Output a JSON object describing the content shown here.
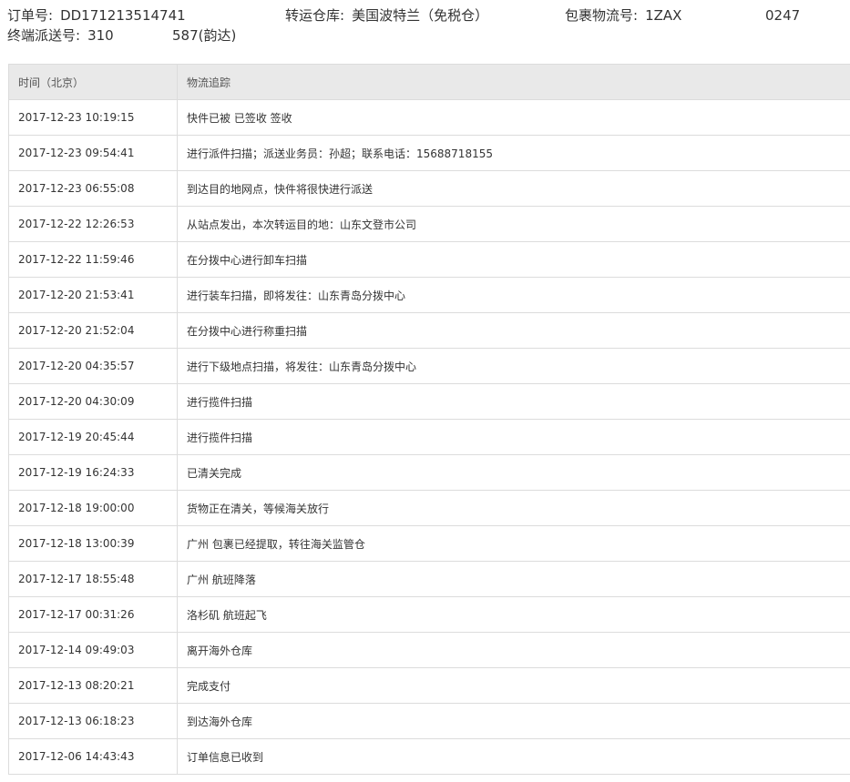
{
  "order": {
    "order_no_label": "订单号:",
    "order_no": "DD171213514741",
    "warehouse_label": "转运仓库:",
    "warehouse": "美国波特兰（免税仓）",
    "parcel_label": "包裹物流号:",
    "parcel_no_a": "1ZAX",
    "parcel_no_b": "0247",
    "delivery_label": "终端派送号:",
    "delivery_no_a": "310",
    "delivery_no_b": "587(韵达)"
  },
  "table": {
    "headers": [
      "时间（北京）",
      "物流追踪"
    ],
    "rows": [
      {
        "time": "2017-12-23 10:19:15",
        "event": "快件已被 已签收 签收"
      },
      {
        "time": "2017-12-23 09:54:41",
        "event": "进行派件扫描；派送业务员：孙超；联系电话：15688718155"
      },
      {
        "time": "2017-12-23 06:55:08",
        "event": "到达目的地网点，快件将很快进行派送"
      },
      {
        "time": "2017-12-22 12:26:53",
        "event": "从站点发出，本次转运目的地：山东文登市公司"
      },
      {
        "time": "2017-12-22 11:59:46",
        "event": "在分拨中心进行卸车扫描"
      },
      {
        "time": "2017-12-20 21:53:41",
        "event": "进行装车扫描，即将发往：山东青岛分拨中心"
      },
      {
        "time": "2017-12-20 21:52:04",
        "event": "在分拨中心进行称重扫描"
      },
      {
        "time": "2017-12-20 04:35:57",
        "event": "进行下级地点扫描，将发往：山东青岛分拨中心"
      },
      {
        "time": "2017-12-20 04:30:09",
        "event": "进行揽件扫描"
      },
      {
        "time": "2017-12-19 20:45:44",
        "event": "进行揽件扫描"
      },
      {
        "time": "2017-12-19 16:24:33",
        "event": "已清关完成"
      },
      {
        "time": "2017-12-18 19:00:00",
        "event": "货物正在清关，等候海关放行"
      },
      {
        "time": "2017-12-18 13:00:39",
        "event": "广州 包裹已经提取，转往海关监管仓"
      },
      {
        "time": "2017-12-17 18:55:48",
        "event": "广州 航班降落"
      },
      {
        "time": "2017-12-17 00:31:26",
        "event": "洛杉矶 航班起飞"
      },
      {
        "time": "2017-12-14 09:49:03",
        "event": "离开海外仓库"
      },
      {
        "time": "2017-12-13 08:20:21",
        "event": "完成支付"
      },
      {
        "time": "2017-12-13 06:18:23",
        "event": "到达海外仓库"
      },
      {
        "time": "2017-12-06 14:43:43",
        "event": "订单信息已收到"
      }
    ]
  }
}
